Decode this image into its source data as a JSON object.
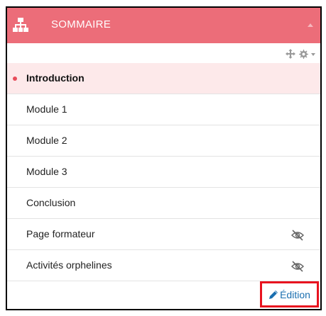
{
  "header": {
    "title": "SOMMAIRE",
    "color": "#ec6d79",
    "logo_icon": "sitemap-icon"
  },
  "tools": {
    "move_icon": "move-arrows-icon",
    "settings_icon": "gear-icon"
  },
  "menu": {
    "items": [
      {
        "label": "Introduction",
        "active": true,
        "hidden": false
      },
      {
        "label": "Module 1",
        "active": false,
        "hidden": false
      },
      {
        "label": "Module 2",
        "active": false,
        "hidden": false
      },
      {
        "label": "Module 3",
        "active": false,
        "hidden": false
      },
      {
        "label": "Conclusion",
        "active": false,
        "hidden": false
      },
      {
        "label": "Page formateur",
        "active": false,
        "hidden": true
      },
      {
        "label": "Activités orphelines",
        "active": false,
        "hidden": true
      }
    ],
    "hidden_icon": "eye-slash-icon"
  },
  "footer": {
    "edit_label": "Édition",
    "edit_icon": "pencil-icon",
    "highlight_color": "#e8131f",
    "link_color": "#1a6fb0"
  }
}
